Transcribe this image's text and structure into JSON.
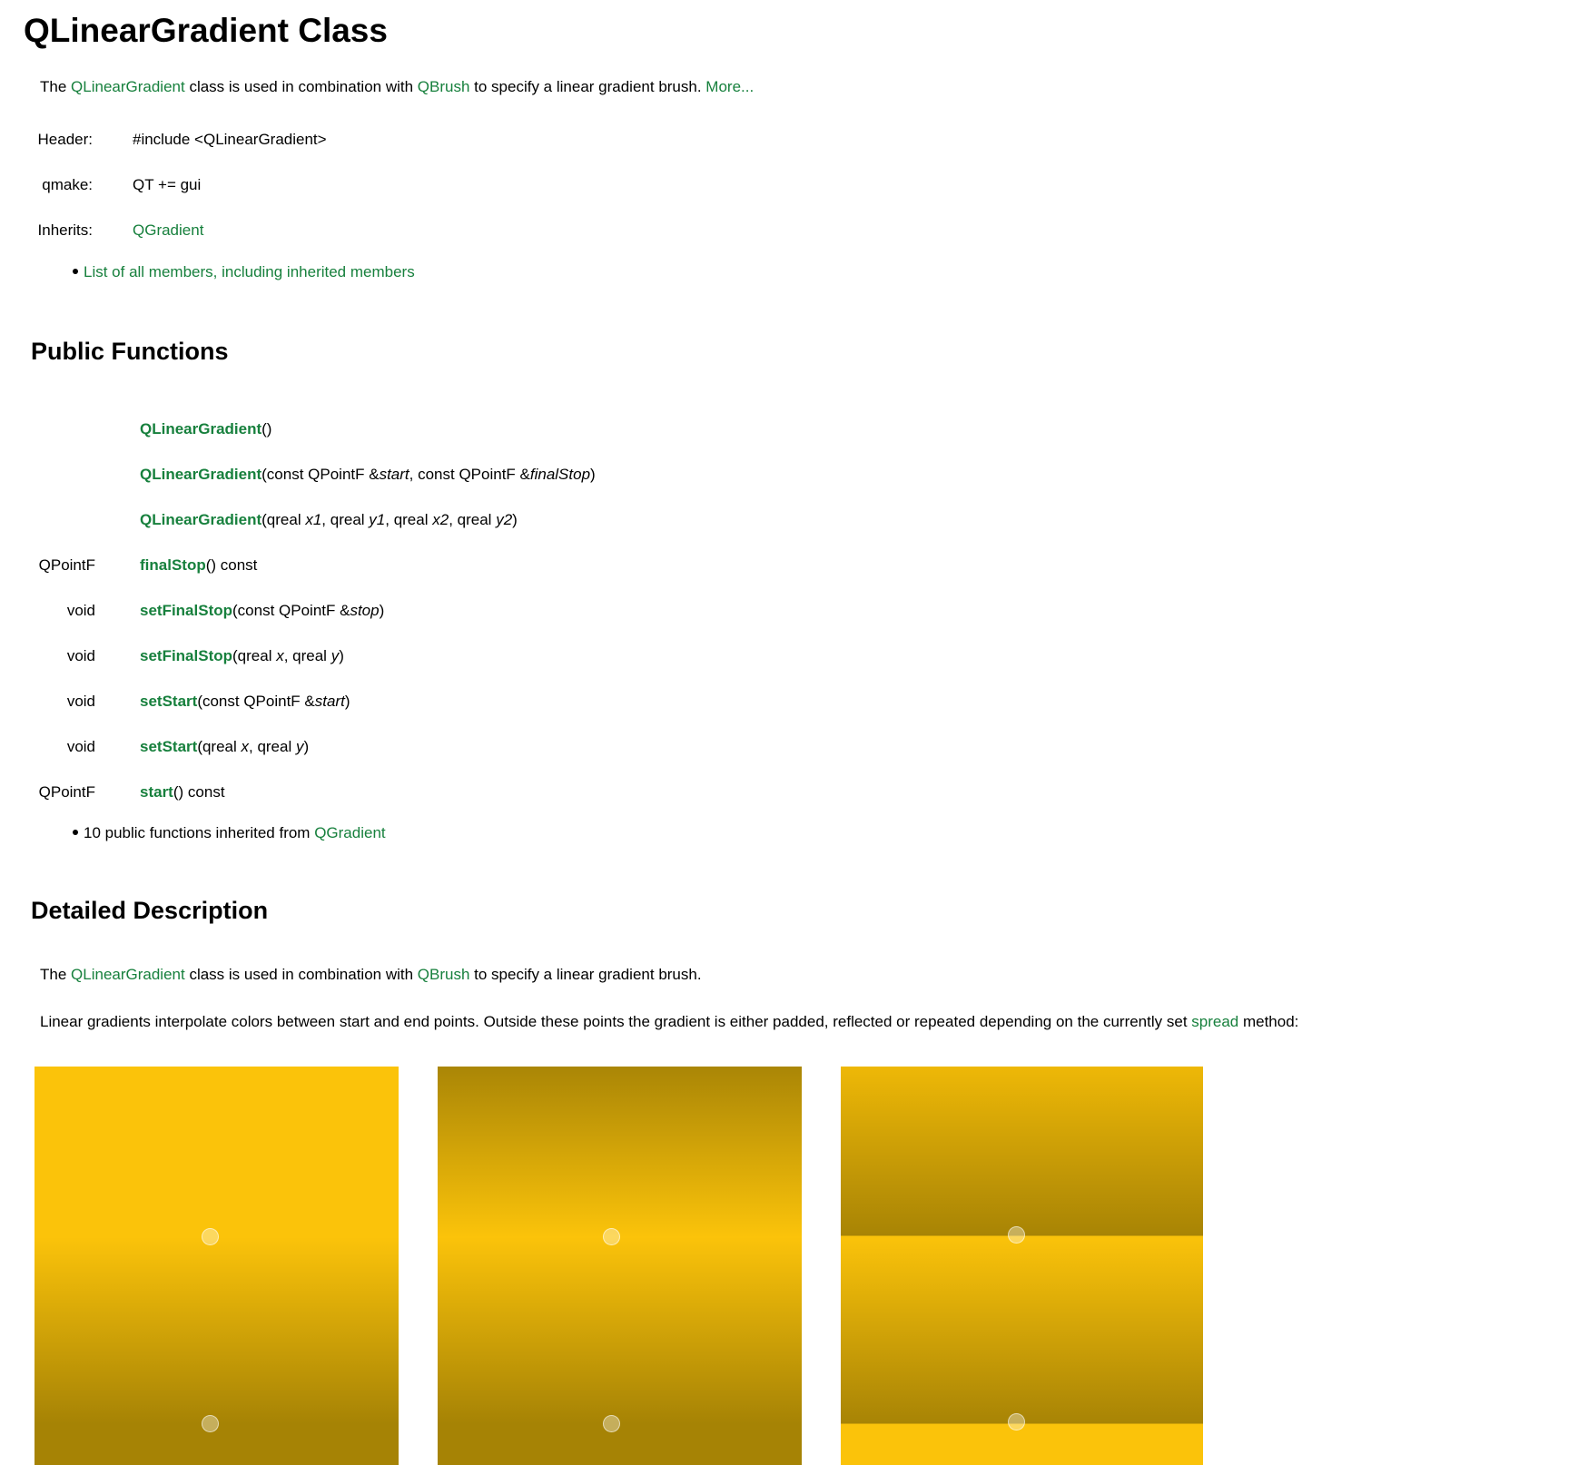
{
  "title": "QLinearGradient Class",
  "intro": {
    "pre": "The ",
    "link1": "QLinearGradient",
    "mid": " class is used in combination with ",
    "link2": "QBrush",
    "post": " to specify a linear gradient brush. ",
    "more": "More..."
  },
  "meta": {
    "header_label": "Header:",
    "header_value": "#include <QLinearGradient>",
    "qmake_label": "qmake:",
    "qmake_value": "QT += gui",
    "inherits_label": "Inherits:",
    "inherits_value": "QGradient",
    "members_link": "List of all members, including inherited members"
  },
  "public_functions": {
    "heading": "Public Functions",
    "rows": [
      {
        "type": "",
        "name": "QLinearGradient",
        "args": "()"
      },
      {
        "type": "",
        "name": "QLinearGradient",
        "args_html": [
          "(const QPointF &",
          "start",
          ", const QPointF &",
          "finalStop",
          ")"
        ]
      },
      {
        "type": "",
        "name": "QLinearGradient",
        "args_html": [
          "(qreal ",
          "x1",
          ", qreal ",
          "y1",
          ", qreal ",
          "x2",
          ", qreal ",
          "y2",
          ")"
        ]
      },
      {
        "type": "QPointF",
        "name": "finalStop",
        "args": "() const"
      },
      {
        "type": "void",
        "name": "setFinalStop",
        "args_html": [
          "(const QPointF &",
          "stop",
          ")"
        ]
      },
      {
        "type": "void",
        "name": "setFinalStop",
        "args_html": [
          "(qreal ",
          "x",
          ", qreal ",
          "y",
          ")"
        ]
      },
      {
        "type": "void",
        "name": "setStart",
        "args_html": [
          "(const QPointF &",
          "start",
          ")"
        ]
      },
      {
        "type": "void",
        "name": "setStart",
        "args_html": [
          "(qreal ",
          "x",
          ", qreal ",
          "y",
          ")"
        ]
      },
      {
        "type": "QPointF",
        "name": "start",
        "args": "() const"
      }
    ],
    "inherited_pre": "10 public functions inherited from ",
    "inherited_link": "QGradient"
  },
  "detailed": {
    "heading": "Detailed Description",
    "p1_pre": "The ",
    "p1_link1": "QLinearGradient",
    "p1_mid": " class is used in combination with ",
    "p1_link2": "QBrush",
    "p1_post": " to specify a linear gradient brush.",
    "p2_pre": "Linear gradients interpolate colors between start and end points. Outside these points the gradient is either padded, reflected or repeated depending on the currently set ",
    "p2_link": "spread",
    "p2_post": " method:"
  },
  "colors": {
    "link": "#17803d",
    "gradient_light": "#fbc30a",
    "gradient_dark": "#a68305"
  },
  "images": [
    {
      "name": "gradient-pad-image",
      "spread": "pad"
    },
    {
      "name": "gradient-reflect-image",
      "spread": "reflect"
    },
    {
      "name": "gradient-repeat-image",
      "spread": "repeat"
    }
  ]
}
